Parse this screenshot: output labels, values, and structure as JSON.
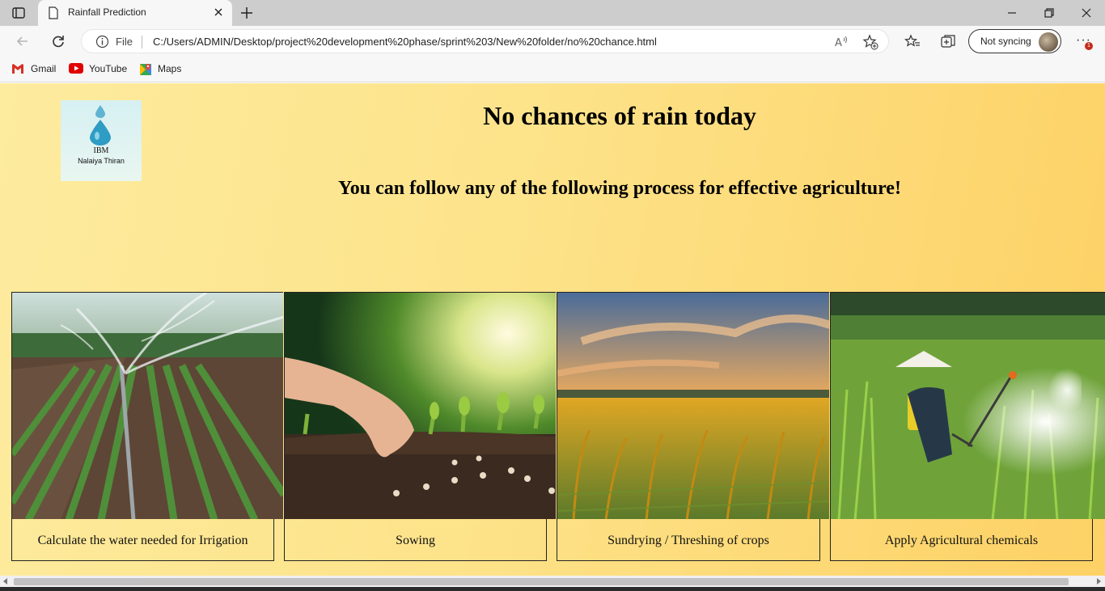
{
  "browser": {
    "tab_title": "Rainfall Prediction",
    "address_prefix": "File",
    "url": "C:/Users/ADMIN/Desktop/project%20development%20phase/sprint%203/New%20folder/no%20chance.html",
    "sync_label": "Not syncing",
    "more_label": "···",
    "notification_count": "1",
    "bookmarks": [
      {
        "label": "Gmail",
        "icon": "gmail-icon"
      },
      {
        "label": "YouTube",
        "icon": "youtube-icon"
      },
      {
        "label": "Maps",
        "icon": "maps-icon"
      }
    ]
  },
  "page": {
    "logo": {
      "line1": "IBM",
      "line2": "Nalaiya Thiran"
    },
    "heading": "No chances of rain today",
    "subheading": "You can follow any of the following process for effective agriculture!",
    "cards": [
      {
        "caption": "Calculate the water needed for Irrigation"
      },
      {
        "caption": "Sowing"
      },
      {
        "caption": "Sundrying / Threshing of crops"
      },
      {
        "caption": "Apply Agricultural chemicals"
      }
    ]
  },
  "colors": {
    "page_bg_start": "#fdeb9e",
    "page_bg_end": "#fdd165",
    "text": "#000000"
  }
}
